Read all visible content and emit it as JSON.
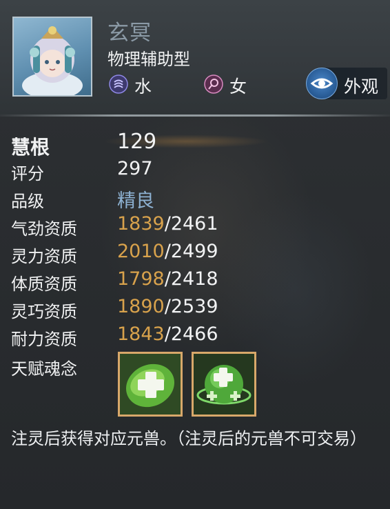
{
  "pet": {
    "name": "玄冥",
    "type": "物理辅助型",
    "element": {
      "label": "水",
      "icon": "water-element-icon",
      "color": "#6a64c8"
    },
    "gender": {
      "label": "女",
      "icon": "female-gender-icon",
      "color": "#c87ab0"
    },
    "avatar_icon": "pet-avatar-portrait"
  },
  "appearance_button": {
    "label": "外观",
    "icon": "eye-icon"
  },
  "stats": {
    "wisdom": {
      "label": "慧根",
      "value": "129"
    },
    "score": {
      "label": "评分",
      "value": "297"
    },
    "grade": {
      "label": "品级",
      "value": "精良"
    }
  },
  "aptitudes": [
    {
      "label": "气劲资质",
      "current": "1839",
      "max": "/2461"
    },
    {
      "label": "灵力资质",
      "current": "2010",
      "max": "/2499"
    },
    {
      "label": "体质资质",
      "current": "1798",
      "max": "/2418"
    },
    {
      "label": "灵巧资质",
      "current": "1890",
      "max": "/2539"
    },
    {
      "label": "耐力资质",
      "current": "1843",
      "max": "/2466"
    }
  ],
  "talent": {
    "label": "天赋魂念",
    "skills": [
      {
        "icon": "heal-leaf-skill-icon"
      },
      {
        "icon": "heal-orb-skill-icon"
      }
    ]
  },
  "footer": "注灵后获得对应元兽。（注灵后的元兽不可交易）",
  "colors": {
    "accent_value": "#d8a24c",
    "grade_color": "#8db1d2",
    "name_color": "#8b9aa6"
  }
}
